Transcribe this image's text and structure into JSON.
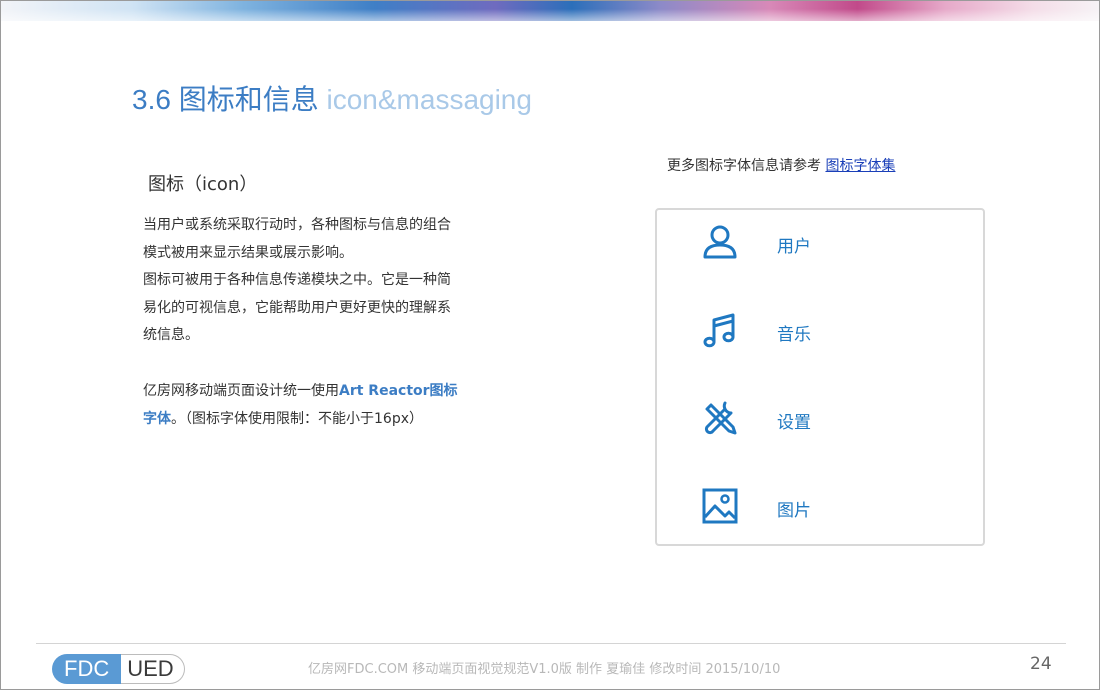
{
  "slide": {
    "title_cn": "3.6 图标和信息",
    "title_en": "icon&massaging",
    "section_heading": "图标（icon）",
    "paragraph1_lines": [
      "当用户或系统采取行动时，各种图标与信息的组合",
      "模式被用来显示结果或展示影响。",
      "图标可被用于各种信息传递模块之中。它是一种简",
      "易化的可视信息，它能帮助用户更好更快的理解系",
      "统信息。"
    ],
    "paragraph2": {
      "prefix": "亿房网移动端页面设计统一使用",
      "highlight1": "Art Reactor图标",
      "highlight2": "字体",
      "suffix": "。（图标字体使用限制：不能小于16px）"
    },
    "reference": {
      "text": "更多图标字体信息请参考 ",
      "link": "图标字体集"
    },
    "icons": [
      {
        "name": "user-icon",
        "label": "用户"
      },
      {
        "name": "music-icon",
        "label": "音乐"
      },
      {
        "name": "settings-tools-icon",
        "label": "设置"
      },
      {
        "name": "image-icon",
        "label": "图片"
      }
    ]
  },
  "footer": {
    "logo_left": "FDC",
    "logo_right": "UED",
    "text": "亿房网FDC.COM 移动端页面视觉规范V1.0版  制作 夏瑜佳   修改时间  2015/10/10",
    "page_number": "24"
  },
  "colors": {
    "accent": "#3c7dc4",
    "icon_blue": "#1f78c1",
    "link": "#1a3fb8"
  }
}
